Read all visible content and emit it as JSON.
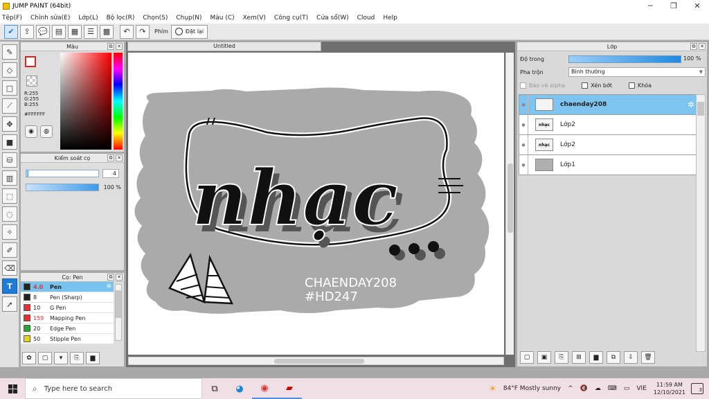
{
  "window": {
    "title": "JUMP PAINT (64bit)",
    "controls": [
      "─",
      "❐",
      "✕"
    ]
  },
  "menu": [
    "Tệp(F)",
    "Chỉnh sửa(E)",
    "Lớp(L)",
    "Bộ lọc(R)",
    "Chọn(S)",
    "Chụp(N)",
    "Màu (C)",
    "Xem(V)",
    "Công cụ(T)",
    "Cửa sổ(W)",
    "Cloud",
    "Help"
  ],
  "toolbar": {
    "key_label": "Phím",
    "reset_label": "Đặt lại"
  },
  "color_panel": {
    "title": "Màu",
    "r": "R:255",
    "g": "G:255",
    "b": "B:255",
    "hex": "#FFFFFF",
    "foreground": "#ffffff",
    "background": "#ffffff"
  },
  "brush_control": {
    "title": "Kiểm soát cọ",
    "size_value": "4",
    "size_fraction": 0.03,
    "opacity_value": "100 %",
    "opacity_fraction": 1.0
  },
  "brush_list": {
    "title": "Cọ: Pen",
    "items": [
      {
        "size": "4.0",
        "name": "Pen",
        "color": "#222222",
        "size_red": true,
        "selected": true
      },
      {
        "size": "8",
        "name": "Pen (Sharp)",
        "color": "#222222",
        "size_red": false,
        "selected": false
      },
      {
        "size": "10",
        "name": "G Pen",
        "color": "#e83030",
        "size_red": false,
        "selected": false
      },
      {
        "size": "159",
        "name": "Mapping Pen",
        "color": "#e83030",
        "size_red": true,
        "selected": false
      },
      {
        "size": "20",
        "name": "Edge Pen",
        "color": "#27a82b",
        "size_red": false,
        "selected": false
      },
      {
        "size": "50",
        "name": "Stipple Pen",
        "color": "#e6d41a",
        "size_red": false,
        "selected": false
      }
    ]
  },
  "document": {
    "tab_title": "Untitled"
  },
  "artwork": {
    "main_word": "nhạc",
    "caption_line1": "CHAENDAY208",
    "caption_line2": "#HD247"
  },
  "layer_panel": {
    "title": "Lớp",
    "opacity_label": "Độ trong",
    "opacity_value": "100 %",
    "opacity_fraction": 1.0,
    "blend_label": "Pha trộn",
    "blend_value": "Bình thường",
    "protect_alpha": "Bảo vệ alpha",
    "clipping": "Xén bớt",
    "lock": "Khóa",
    "layers": [
      {
        "name": "chaenday208",
        "thumb": "",
        "selected": true
      },
      {
        "name": "Lớp2",
        "thumb": "nhạc",
        "selected": false
      },
      {
        "name": "Lớp2",
        "thumb": "nhạc",
        "selected": false
      },
      {
        "name": "Lớp1",
        "thumb": "",
        "selected": false
      }
    ]
  },
  "taskbar": {
    "search_placeholder": "Type here to search",
    "weather": "84°F  Mostly sunny",
    "language": "VIE",
    "time": "11:59 AM",
    "date": "12/10/2021",
    "notifications": "3"
  }
}
